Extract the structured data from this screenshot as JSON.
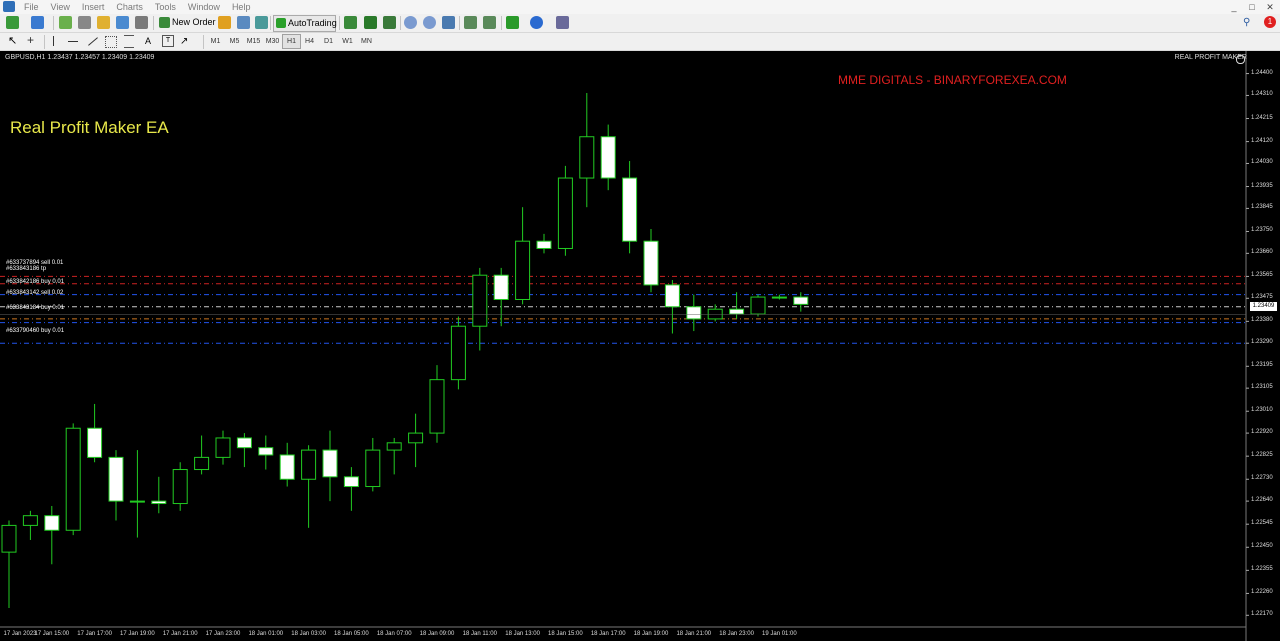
{
  "menubar": {
    "items": [
      "File",
      "View",
      "Insert",
      "Charts",
      "Tools",
      "Window",
      "Help"
    ],
    "window_buttons": [
      "_",
      "□",
      "✕"
    ]
  },
  "toolbar": {
    "new_order_label": "New Order",
    "autotrading_label": "AutoTrading",
    "timeframes": [
      "M1",
      "M5",
      "M15",
      "M30",
      "H1",
      "H4",
      "D1",
      "W1",
      "MN"
    ],
    "active_timeframe": "H1",
    "notification_count": "1"
  },
  "chart": {
    "symbol_info": "GBPUSD,H1  1.23437 1.23457 1.23409 1.23409",
    "tag": "REAL PROFIT MAKER",
    "ea_title": "Real Profit Maker EA",
    "watermark": "MME DIGITALS - BINARYFOREXEA.COM",
    "current_price": "1.23409",
    "colors": {
      "background": "#000000",
      "bull_body": "#000000",
      "bear_body": "#ffffff",
      "wick": "#22cc22",
      "ea_title": "#e8e84a",
      "watermark": "#e02020"
    },
    "order_labels": [
      "#633737894 sell 0.01",
      "#633843186 tp",
      "#633842186 buy 0.01",
      "#633843142 sell 0.02",
      "#633843184 buy 0.01",
      "#633790460 buy 0.01"
    ],
    "price_axis": [
      "1.24400",
      "1.24310",
      "1.24215",
      "1.24120",
      "1.24030",
      "1.23935",
      "1.23845",
      "1.23750",
      "1.23660",
      "1.23565",
      "1.23475",
      "1.23380",
      "1.23290",
      "1.23195",
      "1.23105",
      "1.23010",
      "1.22920",
      "1.22825",
      "1.22730",
      "1.22640",
      "1.22545",
      "1.22450",
      "1.22355",
      "1.22260",
      "1.22170"
    ],
    "time_axis": [
      "17 Jan 2023",
      "17 Jan 15:00",
      "17 Jan 17:00",
      "17 Jan 19:00",
      "17 Jan 21:00",
      "17 Jan 23:00",
      "18 Jan 01:00",
      "18 Jan 03:00",
      "18 Jan 05:00",
      "18 Jan 07:00",
      "18 Jan 09:00",
      "18 Jan 11:00",
      "18 Jan 13:00",
      "18 Jan 15:00",
      "18 Jan 17:00",
      "18 Jan 19:00",
      "18 Jan 21:00",
      "18 Jan 23:00",
      "19 Jan 01:00"
    ]
  },
  "chart_data": {
    "type": "candlestick",
    "symbol": "GBPUSD",
    "timeframe": "H1",
    "candles": [
      {
        "o": 1.2243,
        "h": 1.2256,
        "l": 1.222,
        "c": 1.2254
      },
      {
        "o": 1.2254,
        "h": 1.226,
        "l": 1.2248,
        "c": 1.2258
      },
      {
        "o": 1.2258,
        "h": 1.2262,
        "l": 1.2238,
        "c": 1.2252
      },
      {
        "o": 1.2252,
        "h": 1.2296,
        "l": 1.225,
        "c": 1.2294
      },
      {
        "o": 1.2294,
        "h": 1.2304,
        "l": 1.228,
        "c": 1.2282
      },
      {
        "o": 1.2282,
        "h": 1.2285,
        "l": 1.2256,
        "c": 1.2264
      },
      {
        "o": 1.2264,
        "h": 1.2285,
        "l": 1.2249,
        "c": 1.2264
      },
      {
        "o": 1.2264,
        "h": 1.2274,
        "l": 1.2259,
        "c": 1.2263
      },
      {
        "o": 1.2263,
        "h": 1.228,
        "l": 1.226,
        "c": 1.2277
      },
      {
        "o": 1.2277,
        "h": 1.2291,
        "l": 1.2275,
        "c": 1.2282
      },
      {
        "o": 1.2282,
        "h": 1.2293,
        "l": 1.2279,
        "c": 1.229
      },
      {
        "o": 1.229,
        "h": 1.2292,
        "l": 1.2278,
        "c": 1.2286
      },
      {
        "o": 1.2286,
        "h": 1.2291,
        "l": 1.2277,
        "c": 1.2283
      },
      {
        "o": 1.2283,
        "h": 1.2288,
        "l": 1.227,
        "c": 1.2273
      },
      {
        "o": 1.2273,
        "h": 1.2287,
        "l": 1.2253,
        "c": 1.2285
      },
      {
        "o": 1.2285,
        "h": 1.2293,
        "l": 1.2264,
        "c": 1.2274
      },
      {
        "o": 1.2274,
        "h": 1.2278,
        "l": 1.226,
        "c": 1.227
      },
      {
        "o": 1.227,
        "h": 1.229,
        "l": 1.2268,
        "c": 1.2285
      },
      {
        "o": 1.2285,
        "h": 1.229,
        "l": 1.2275,
        "c": 1.2288
      },
      {
        "o": 1.2288,
        "h": 1.23,
        "l": 1.2278,
        "c": 1.2292
      },
      {
        "o": 1.2292,
        "h": 1.232,
        "l": 1.2288,
        "c": 1.2314
      },
      {
        "o": 1.2314,
        "h": 1.234,
        "l": 1.231,
        "c": 1.2336
      },
      {
        "o": 1.2336,
        "h": 1.236,
        "l": 1.2326,
        "c": 1.2357
      },
      {
        "o": 1.2357,
        "h": 1.236,
        "l": 1.2336,
        "c": 1.2347
      },
      {
        "o": 1.2347,
        "h": 1.2385,
        "l": 1.2345,
        "c": 1.2371
      },
      {
        "o": 1.2371,
        "h": 1.2374,
        "l": 1.2366,
        "c": 1.2368
      },
      {
        "o": 1.2368,
        "h": 1.2402,
        "l": 1.2365,
        "c": 1.2397
      },
      {
        "o": 1.2397,
        "h": 1.2432,
        "l": 1.2385,
        "c": 1.2414
      },
      {
        "o": 1.2414,
        "h": 1.2419,
        "l": 1.2392,
        "c": 1.2397
      },
      {
        "o": 1.2397,
        "h": 1.2404,
        "l": 1.2366,
        "c": 1.2371
      },
      {
        "o": 1.2371,
        "h": 1.2376,
        "l": 1.235,
        "c": 1.2353
      },
      {
        "o": 1.2353,
        "h": 1.2355,
        "l": 1.2333,
        "c": 1.2344
      },
      {
        "o": 1.2344,
        "h": 1.2349,
        "l": 1.2334,
        "c": 1.2339
      },
      {
        "o": 1.2339,
        "h": 1.2345,
        "l": 1.2338,
        "c": 1.2343
      },
      {
        "o": 1.2343,
        "h": 1.235,
        "l": 1.2339,
        "c": 1.2341
      },
      {
        "o": 1.2341,
        "h": 1.2349,
        "l": 1.234,
        "c": 1.2348
      },
      {
        "o": 1.2348,
        "h": 1.2349,
        "l": 1.2347,
        "c": 1.2348
      },
      {
        "o": 1.2348,
        "h": 1.235,
        "l": 1.2342,
        "c": 1.2345
      }
    ],
    "order_lines": [
      {
        "price": 1.23565,
        "color": "#cc2222"
      },
      {
        "price": 1.23535,
        "color": "#cc2222"
      },
      {
        "price": 1.2349,
        "color": "#2255ee"
      },
      {
        "price": 1.2344,
        "color": "#cccccc"
      },
      {
        "price": 1.2339,
        "color": "#cc7722"
      },
      {
        "price": 1.23375,
        "color": "#2255ee"
      },
      {
        "price": 1.2329,
        "color": "#2255ee"
      }
    ],
    "ylim": [
      1.2213,
      1.2446
    ],
    "grid": false
  }
}
